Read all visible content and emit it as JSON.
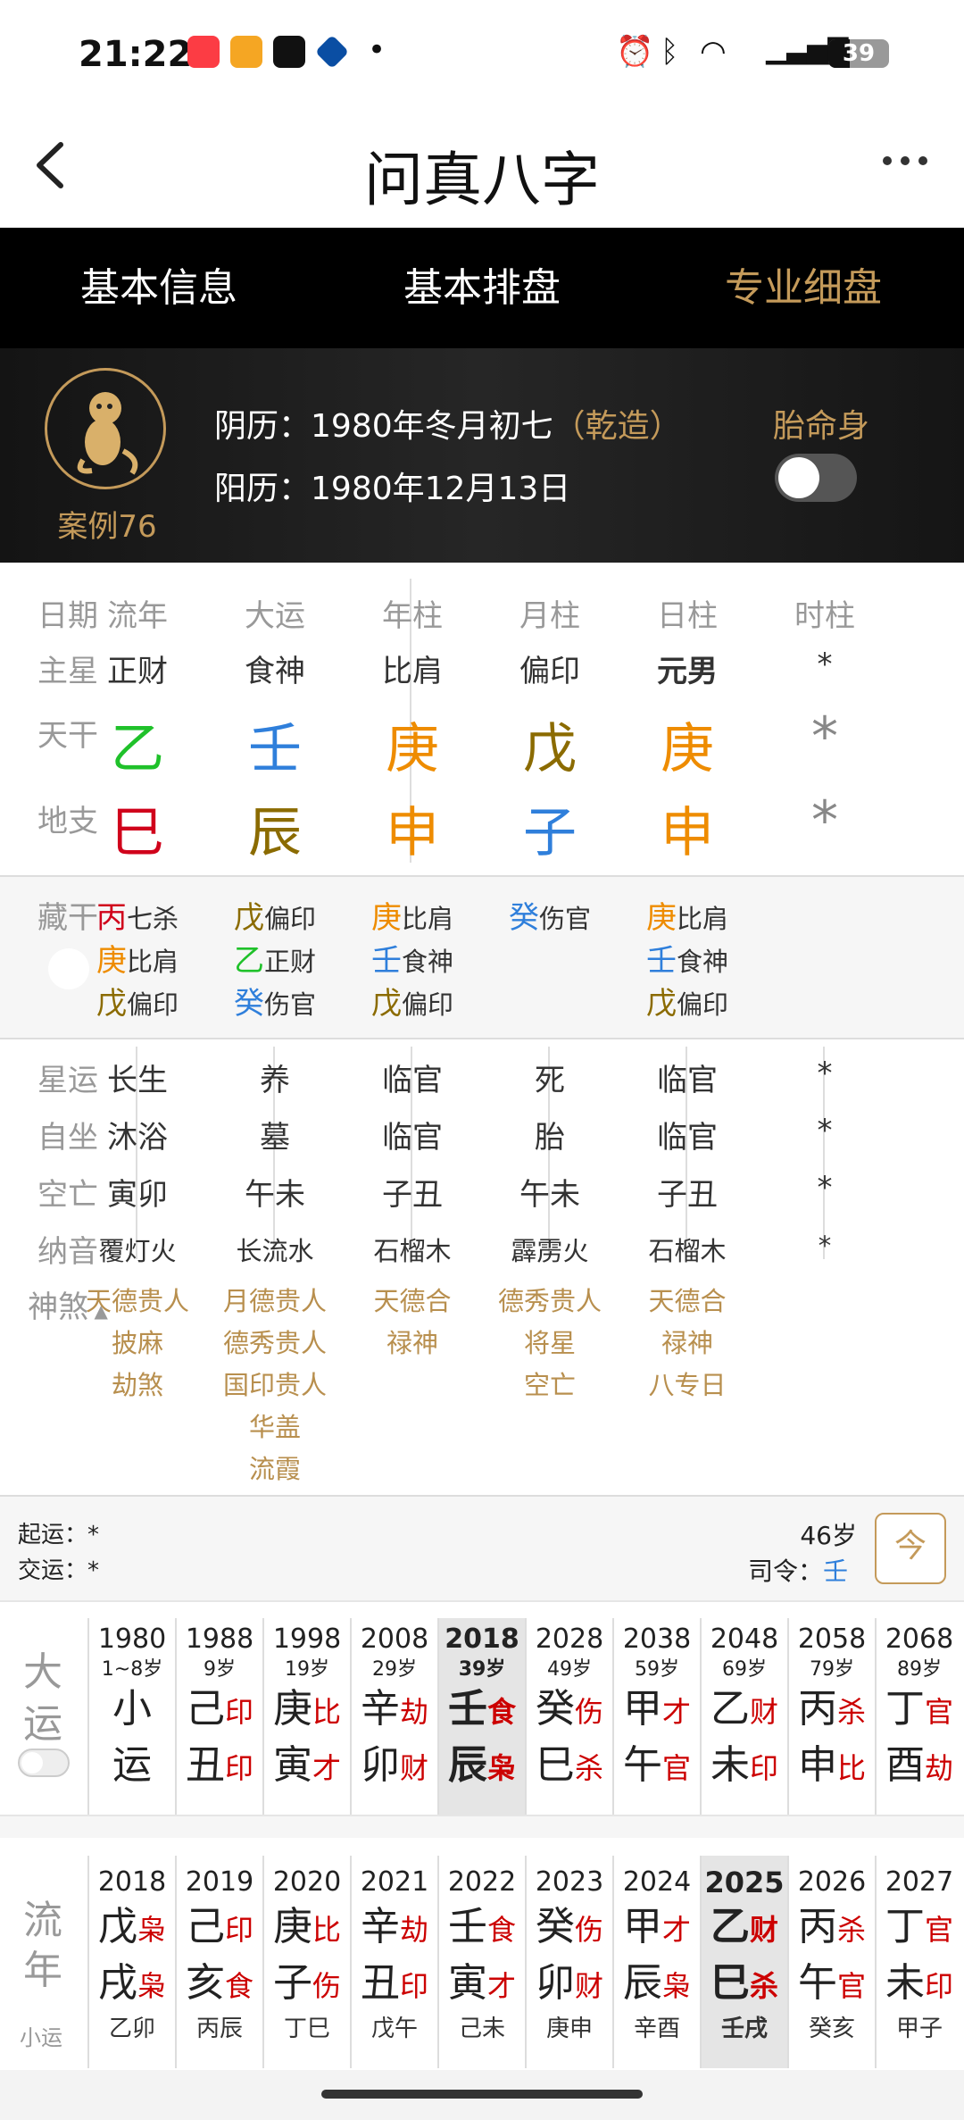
{
  "status_bar": {
    "time": "21:22",
    "battery": "39",
    "network": "5G"
  },
  "header": {
    "title": "问真八字"
  },
  "tabs": [
    "基本信息",
    "基本排盘",
    "专业细盘"
  ],
  "profile": {
    "case": "案例76",
    "lunar_label": "阴历：",
    "lunar": "1980年冬月初七",
    "qianzao": "（乾造）",
    "solar_label": "阳历：",
    "solar": "1980年12月13日",
    "taiming_label": "胎命身"
  },
  "row_labels": {
    "date": "日期",
    "zhuxing": "主星",
    "tiangan": "天干",
    "dizhi": "地支",
    "canggan": "藏干",
    "xingyun": "星运",
    "zizuo": "自坐",
    "kongwang": "空亡",
    "nayin": "纳音",
    "shensha": "神煞"
  },
  "pillars": [
    {
      "name": "流年",
      "zhuxing": "正财",
      "gan": "乙",
      "gan_color": "#1fc12a",
      "zhi": "巳",
      "zhi_color": "#d0021b",
      "xingyun": "长生",
      "zizuo": "沐浴",
      "kongwang": "寅卯",
      "nayin": "覆灯火",
      "canggan": [
        {
          "c": "丙",
          "col": "#d0021b",
          "g": "七杀"
        },
        {
          "c": "庚",
          "col": "#ee8c00",
          "g": "比肩"
        },
        {
          "c": "戊",
          "col": "#8b6b00",
          "g": "偏印"
        }
      ],
      "shensha": [
        "天德贵人",
        "披麻",
        "劫煞"
      ]
    },
    {
      "name": "大运",
      "zhuxing": "食神",
      "gan": "壬",
      "gan_color": "#2f7fdb",
      "zhi": "辰",
      "zhi_color": "#8b6b00",
      "xingyun": "养",
      "zizuo": "墓",
      "kongwang": "午未",
      "nayin": "长流水",
      "canggan": [
        {
          "c": "戊",
          "col": "#8b6b00",
          "g": "偏印"
        },
        {
          "c": "乙",
          "col": "#1fc12a",
          "g": "正财"
        },
        {
          "c": "癸",
          "col": "#2f7fdb",
          "g": "伤官"
        }
      ],
      "shensha": [
        "月德贵人",
        "德秀贵人",
        "国印贵人",
        "华盖",
        "流霞"
      ]
    },
    {
      "name": "年柱",
      "zhuxing": "比肩",
      "gan": "庚",
      "gan_color": "#ee8c00",
      "zhi": "申",
      "zhi_color": "#ee8c00",
      "xingyun": "临官",
      "zizuo": "临官",
      "kongwang": "子丑",
      "nayin": "石榴木",
      "canggan": [
        {
          "c": "庚",
          "col": "#ee8c00",
          "g": "比肩"
        },
        {
          "c": "壬",
          "col": "#2f7fdb",
          "g": "食神"
        },
        {
          "c": "戊",
          "col": "#8b6b00",
          "g": "偏印"
        }
      ],
      "shensha": [
        "天德合",
        "禄神"
      ]
    },
    {
      "name": "月柱",
      "zhuxing": "偏印",
      "gan": "戊",
      "gan_color": "#8b6b00",
      "zhi": "子",
      "zhi_color": "#2f7fdb",
      "xingyun": "死",
      "zizuo": "胎",
      "kongwang": "午未",
      "nayin": "霹雳火",
      "canggan": [
        {
          "c": "癸",
          "col": "#2f7fdb",
          "g": "伤官"
        }
      ],
      "shensha": [
        "德秀贵人",
        "将星",
        "空亡"
      ]
    },
    {
      "name": "日柱",
      "zhuxing": "元男",
      "gan": "庚",
      "gan_color": "#ee8c00",
      "zhi": "申",
      "zhi_color": "#ee8c00",
      "xingyun": "临官",
      "zizuo": "临官",
      "kongwang": "子丑",
      "nayin": "石榴木",
      "canggan": [
        {
          "c": "庚",
          "col": "#ee8c00",
          "g": "比肩"
        },
        {
          "c": "壬",
          "col": "#2f7fdb",
          "g": "食神"
        },
        {
          "c": "戊",
          "col": "#8b6b00",
          "g": "偏印"
        }
      ],
      "shensha": [
        "天德合",
        "禄神",
        "八专日"
      ]
    },
    {
      "name": "时柱",
      "zhuxing": "*",
      "gan": "*",
      "gan_color": "#888888",
      "zhi": "*",
      "zhi_color": "#888888",
      "xingyun": "*",
      "zizuo": "*",
      "kongwang": "*",
      "nayin": "*",
      "canggan": [],
      "shensha": []
    }
  ],
  "yun_info": {
    "qiyun_label": "起运：",
    "qiyun": "*",
    "jiaoyun_label": "交运：",
    "jiaoyun": "*",
    "age": "46岁",
    "siling_label": "司令：",
    "siling": "壬",
    "today_icon": "今"
  },
  "dayun": {
    "label_top": "大",
    "label_bottom": "运",
    "cols": [
      {
        "year": "1980",
        "age": "1~8岁",
        "g1": "小",
        "god1": "",
        "g2": "运",
        "god2": ""
      },
      {
        "year": "1988",
        "age": "9岁",
        "g1": "己",
        "god1": "印",
        "g2": "丑",
        "god2": "印"
      },
      {
        "year": "1998",
        "age": "19岁",
        "g1": "庚",
        "god1": "比",
        "g2": "寅",
        "god2": "才"
      },
      {
        "year": "2008",
        "age": "29岁",
        "g1": "辛",
        "god1": "劫",
        "g2": "卯",
        "god2": "财"
      },
      {
        "year": "2018",
        "age": "39岁",
        "g1": "壬",
        "god1": "食",
        "g2": "辰",
        "god2": "枭",
        "selected": true
      },
      {
        "year": "2028",
        "age": "49岁",
        "g1": "癸",
        "god1": "伤",
        "g2": "巳",
        "god2": "杀"
      },
      {
        "year": "2038",
        "age": "59岁",
        "g1": "甲",
        "god1": "才",
        "g2": "午",
        "god2": "官"
      },
      {
        "year": "2048",
        "age": "69岁",
        "g1": "乙",
        "god1": "财",
        "g2": "未",
        "god2": "印"
      },
      {
        "year": "2058",
        "age": "79岁",
        "g1": "丙",
        "god1": "杀",
        "g2": "申",
        "god2": "比"
      },
      {
        "year": "2068",
        "age": "89岁",
        "g1": "丁",
        "god1": "官",
        "g2": "酉",
        "god2": "劫"
      }
    ]
  },
  "liunian": {
    "label_top": "流",
    "label_bottom": "年",
    "xiaoyun": "小运",
    "cols": [
      {
        "year": "2018",
        "g1": "戊",
        "god1": "枭",
        "g2": "戌",
        "god2": "枭",
        "xy": "乙卯"
      },
      {
        "year": "2019",
        "g1": "己",
        "god1": "印",
        "g2": "亥",
        "god2": "食",
        "xy": "丙辰"
      },
      {
        "year": "2020",
        "g1": "庚",
        "god1": "比",
        "g2": "子",
        "god2": "伤",
        "xy": "丁巳"
      },
      {
        "year": "2021",
        "g1": "辛",
        "god1": "劫",
        "g2": "丑",
        "god2": "印",
        "xy": "戊午"
      },
      {
        "year": "2022",
        "g1": "壬",
        "god1": "食",
        "g2": "寅",
        "god2": "才",
        "xy": "己未"
      },
      {
        "year": "2023",
        "g1": "癸",
        "god1": "伤",
        "g2": "卯",
        "god2": "财",
        "xy": "庚申"
      },
      {
        "year": "2024",
        "g1": "甲",
        "god1": "才",
        "g2": "辰",
        "god2": "枭",
        "xy": "辛酉"
      },
      {
        "year": "2025",
        "g1": "乙",
        "god1": "财",
        "g2": "巳",
        "god2": "杀",
        "xy": "壬戌",
        "selected": true
      },
      {
        "year": "2026",
        "g1": "丙",
        "god1": "杀",
        "g2": "午",
        "god2": "官",
        "xy": "癸亥"
      },
      {
        "year": "2027",
        "g1": "丁",
        "god1": "官",
        "g2": "未",
        "god2": "印",
        "xy": "甲子"
      }
    ]
  }
}
